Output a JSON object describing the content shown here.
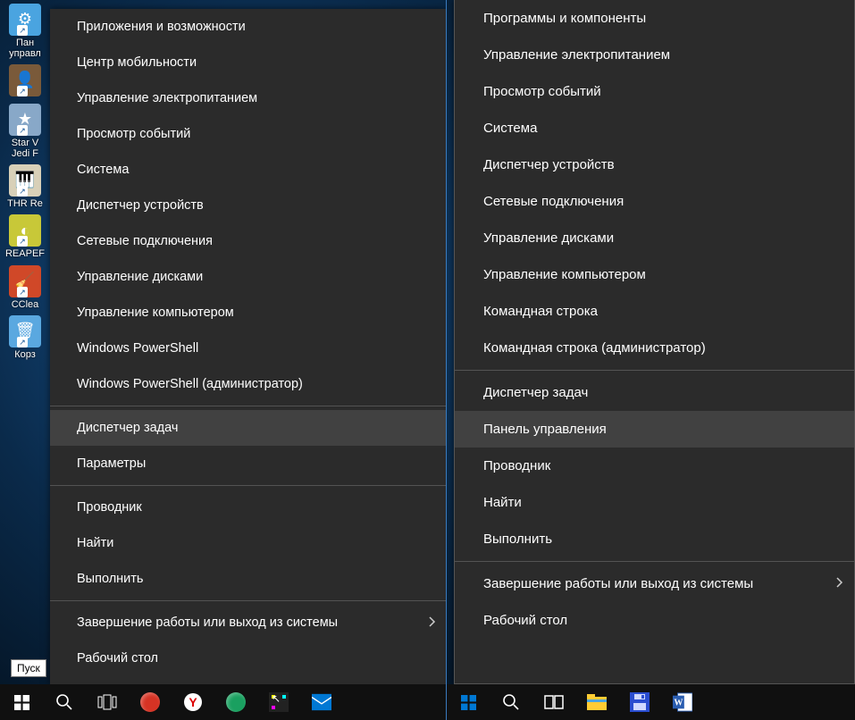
{
  "tooltip": "Пуск",
  "desktop_icons": [
    {
      "label1": "Пан",
      "label2": "управл",
      "color": "#4aa4e0",
      "glyph": "⚙"
    },
    {
      "label1": "",
      "label2": "",
      "color": "#7a5a3a",
      "glyph": "👤"
    },
    {
      "label1": "Star V",
      "label2": "Jedi F",
      "color": "#88a8c8",
      "glyph": "★"
    },
    {
      "label1": "THR Re",
      "label2": "",
      "color": "#d8d0b8",
      "glyph": "🎹"
    },
    {
      "label1": "REAPEF",
      "label2": "",
      "color": "#c8c838",
      "glyph": "◐"
    },
    {
      "label1": "CCleа",
      "label2": "",
      "color": "#d04828",
      "glyph": "🧹"
    },
    {
      "label1": "Корз",
      "label2": "",
      "color": "#5aa8e0",
      "glyph": "🗑"
    }
  ],
  "left_menu": {
    "groups": [
      {
        "items": [
          {
            "key": "apps",
            "label": "Приложения и возможности"
          },
          {
            "key": "mobility",
            "label": "Центр мобильности"
          },
          {
            "key": "power-opts",
            "label": "Управление электропитанием"
          },
          {
            "key": "event-viewer",
            "label": "Просмотр событий"
          },
          {
            "key": "system",
            "label": "Система"
          },
          {
            "key": "device-mgr",
            "label": "Диспетчер устройств"
          },
          {
            "key": "net-conn",
            "label": "Сетевые подключения"
          },
          {
            "key": "disk-mgmt",
            "label": "Управление дисками"
          },
          {
            "key": "comp-mgmt",
            "label": "Управление компьютером"
          },
          {
            "key": "powershell",
            "label": "Windows PowerShell"
          },
          {
            "key": "powershell-admin",
            "label": "Windows PowerShell (администратор)"
          }
        ]
      },
      {
        "items": [
          {
            "key": "taskmgr",
            "label": "Диспетчер задач",
            "highlight": true
          },
          {
            "key": "settings",
            "label": "Параметры"
          }
        ]
      },
      {
        "items": [
          {
            "key": "explorer",
            "label": "Проводник"
          },
          {
            "key": "search",
            "label": "Найти"
          },
          {
            "key": "run",
            "label": "Выполнить"
          }
        ]
      },
      {
        "items": [
          {
            "key": "shutdown",
            "label": "Завершение работы или выход из системы",
            "chevron": true
          },
          {
            "key": "desktop",
            "label": "Рабочий стол"
          }
        ]
      }
    ]
  },
  "right_menu": {
    "groups": [
      {
        "items": [
          {
            "key": "programs",
            "label": "Программы и компоненты"
          },
          {
            "key": "power-opts",
            "label": "Управление электропитанием"
          },
          {
            "key": "event-viewer",
            "label": "Просмотр событий"
          },
          {
            "key": "system",
            "label": "Система"
          },
          {
            "key": "device-mgr",
            "label": "Диспетчер устройств"
          },
          {
            "key": "net-conn",
            "label": "Сетевые подключения"
          },
          {
            "key": "disk-mgmt",
            "label": "Управление дисками"
          },
          {
            "key": "comp-mgmt",
            "label": "Управление компьютером"
          },
          {
            "key": "cmd",
            "label": "Командная строка"
          },
          {
            "key": "cmd-admin",
            "label": "Командная строка (администратор)"
          }
        ]
      },
      {
        "items": [
          {
            "key": "taskmgr",
            "label": "Диспетчер задач"
          },
          {
            "key": "ctrlpanel",
            "label": "Панель управления",
            "highlight": true
          },
          {
            "key": "explorer",
            "label": "Проводник"
          },
          {
            "key": "search",
            "label": "Найти"
          },
          {
            "key": "run",
            "label": "Выполнить"
          }
        ]
      },
      {
        "items": [
          {
            "key": "shutdown",
            "label": "Завершение работы или выход из системы",
            "chevron": true
          },
          {
            "key": "desktop",
            "label": "Рабочий стол"
          }
        ]
      }
    ]
  },
  "taskbar_left": [
    {
      "name": "start",
      "type": "start"
    },
    {
      "name": "search",
      "type": "search"
    },
    {
      "name": "taskview",
      "type": "taskview"
    },
    {
      "name": "opera",
      "type": "color",
      "color": "#d63324",
      "shape": "circle"
    },
    {
      "name": "yandex",
      "type": "yandex"
    },
    {
      "name": "browser2",
      "type": "color",
      "color": "#1aa060",
      "shape": "circle"
    },
    {
      "name": "app1",
      "type": "color",
      "color": "#222",
      "shape": "sq",
      "dots": true
    },
    {
      "name": "mail",
      "type": "mail"
    }
  ],
  "taskbar_right": [
    {
      "name": "start",
      "type": "start"
    },
    {
      "name": "search",
      "type": "search"
    },
    {
      "name": "taskview",
      "type": "taskview2"
    },
    {
      "name": "explorer",
      "type": "explorer"
    },
    {
      "name": "save",
      "type": "floppy"
    },
    {
      "name": "word",
      "type": "word"
    }
  ]
}
